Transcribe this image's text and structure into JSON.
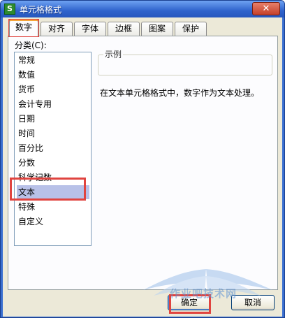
{
  "window": {
    "title": "单元格格式",
    "app_icon_letter": "S",
    "close_glyph": "✕"
  },
  "tabs": [
    {
      "label": "数字",
      "active": true
    },
    {
      "label": "对齐"
    },
    {
      "label": "字体"
    },
    {
      "label": "边框"
    },
    {
      "label": "图案"
    },
    {
      "label": "保护"
    }
  ],
  "category": {
    "label": "分类(C):",
    "items": [
      "常规",
      "数值",
      "货币",
      "会计专用",
      "日期",
      "时间",
      "百分比",
      "分数",
      "科学记数",
      "文本",
      "特殊",
      "自定义"
    ],
    "selected": "文本"
  },
  "example": {
    "title": "示例",
    "value": ""
  },
  "description": "在文本单元格格式中，数字作为文本处理。",
  "buttons": {
    "ok": "确定",
    "cancel": "取消"
  },
  "watermark": {
    "text": "作业吧技术网"
  },
  "colors": {
    "highlight": "#e0443f",
    "selection": "#b8c1e8",
    "titlebar": "#2f63cc"
  }
}
